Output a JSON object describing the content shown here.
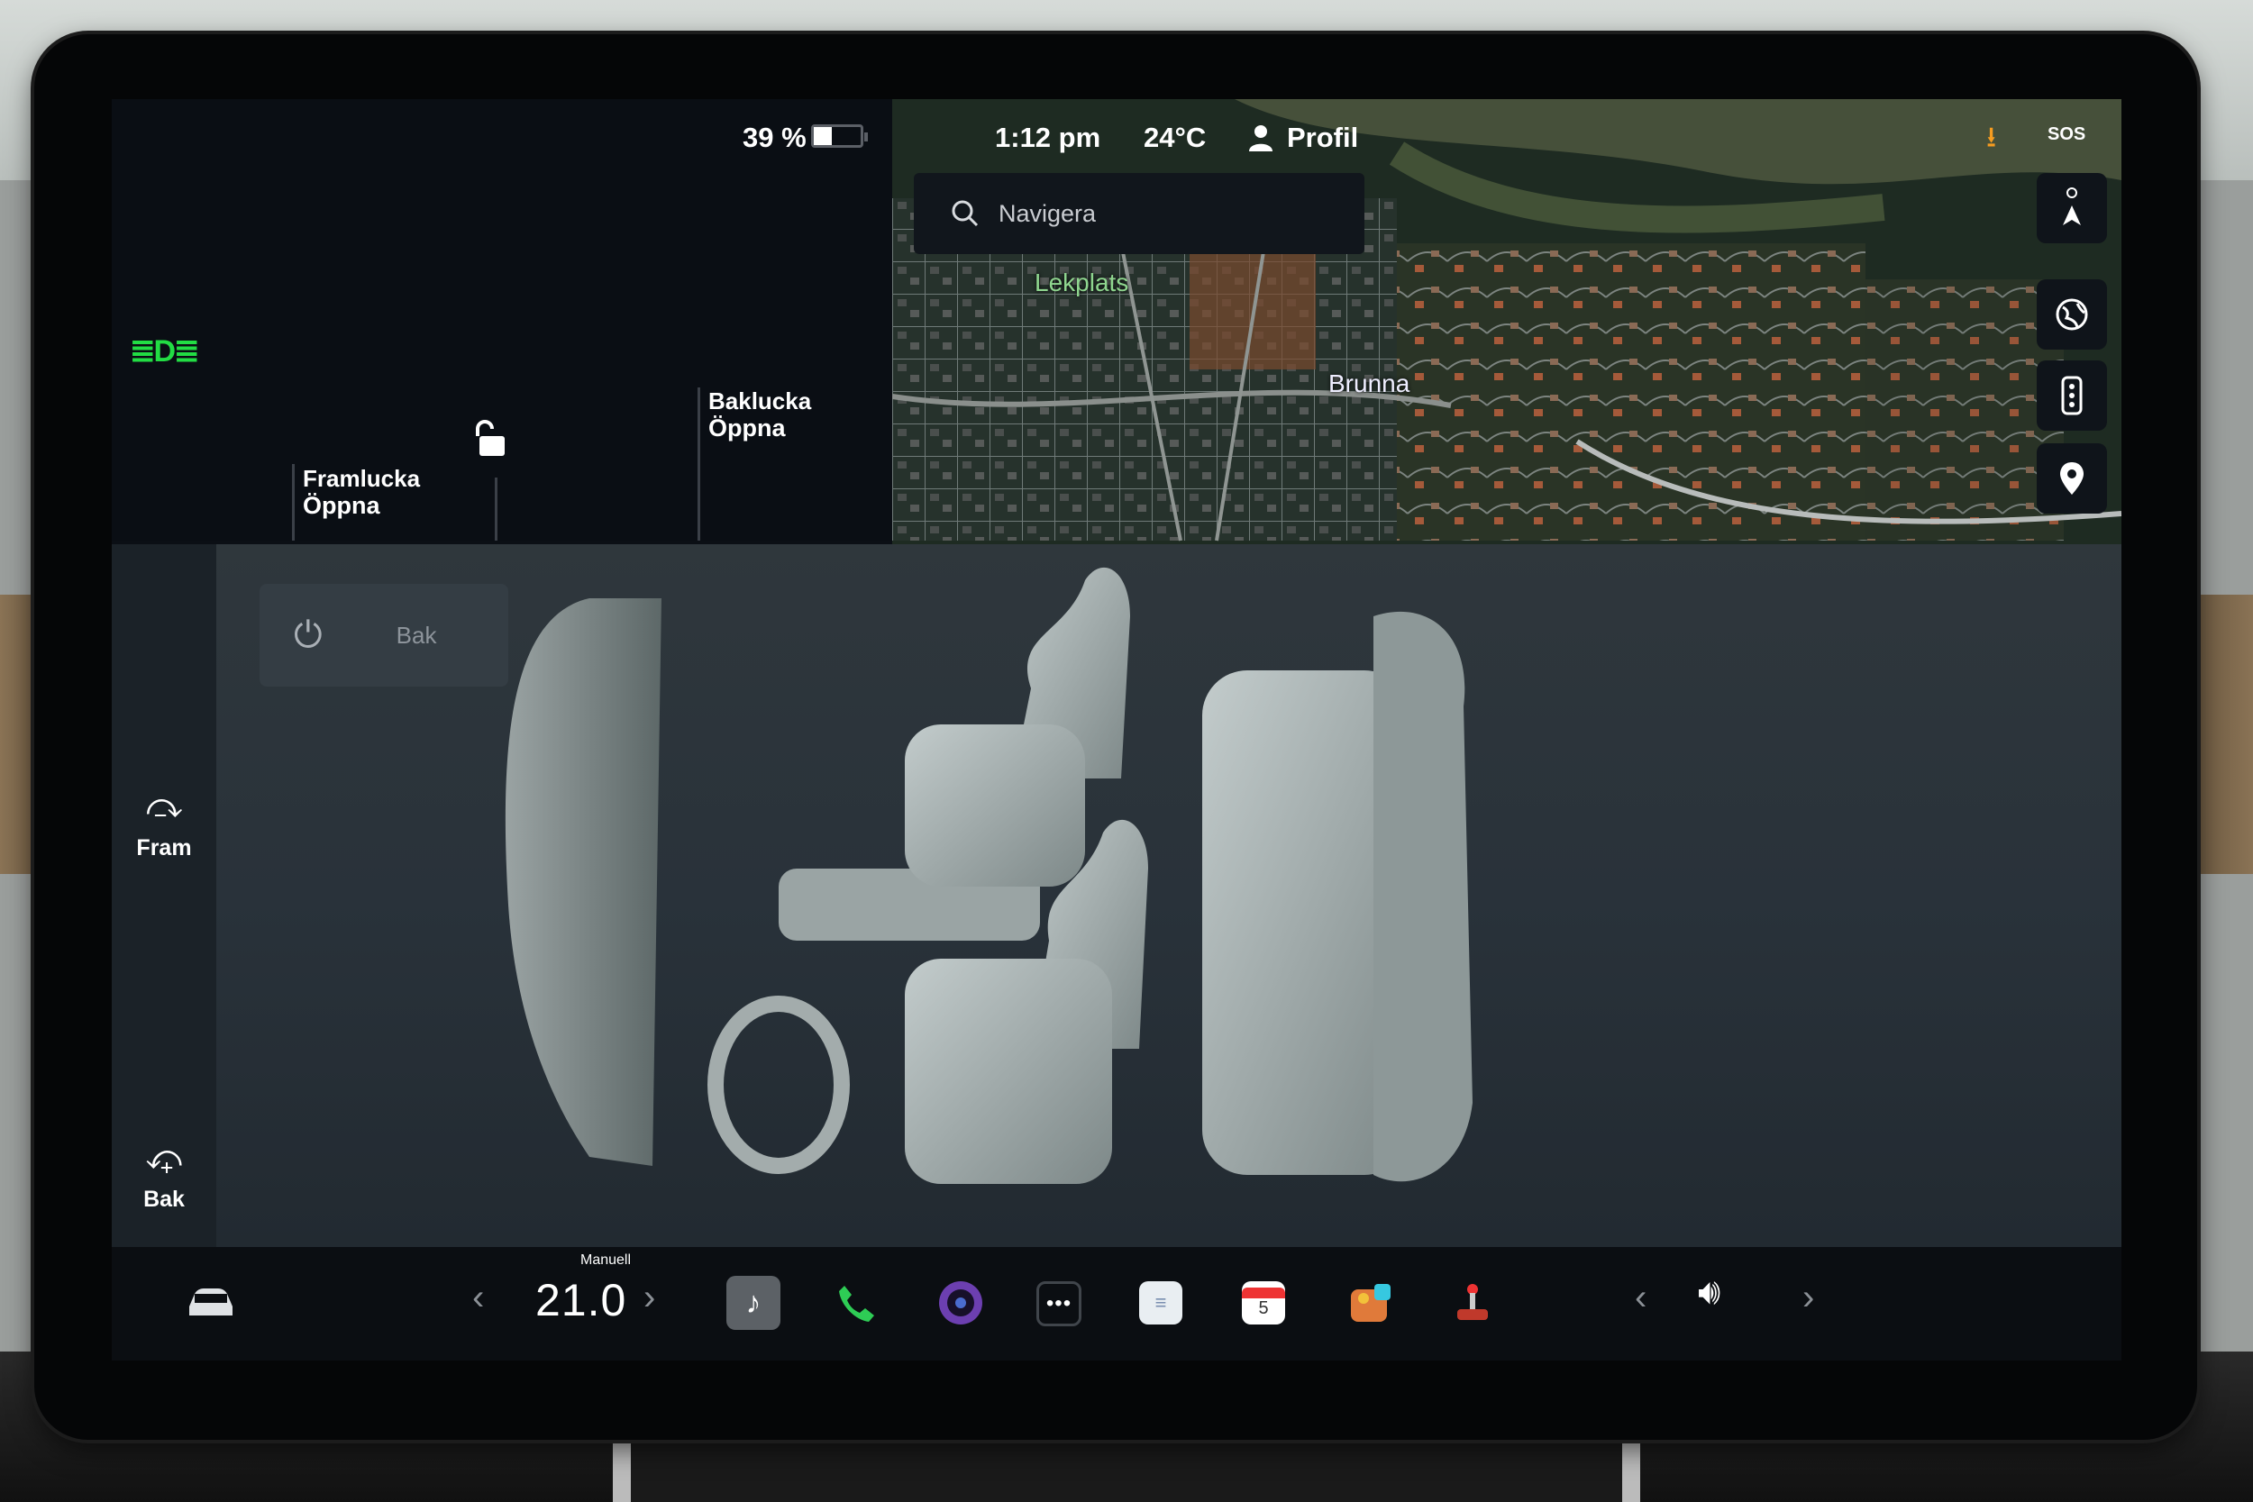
{
  "status": {
    "battery_percent": "39 %",
    "battery_level": 0.39,
    "time": "1:12 pm",
    "temperature": "24°C",
    "profile_label": "Profil"
  },
  "doors": {
    "frunk": {
      "title": "Framlucka",
      "action": "Öppna"
    },
    "trunk": {
      "title": "Baklucka",
      "action": "Öppna"
    }
  },
  "map": {
    "search_placeholder": "Navigera",
    "labels": [
      "Lekplats",
      "Brunna"
    ]
  },
  "climate": {
    "front_vent_label": "Fram",
    "rear_vent_label": "Bak",
    "rear_toggle_label": "Bak"
  },
  "dock": {
    "mode_label": "Manuell",
    "cabin_temp": "21.0",
    "calendar_day": "5"
  },
  "colors": {
    "accent_green": "#22dd44",
    "download_orange": "#f59c20",
    "phone_green": "#2ecc55"
  }
}
